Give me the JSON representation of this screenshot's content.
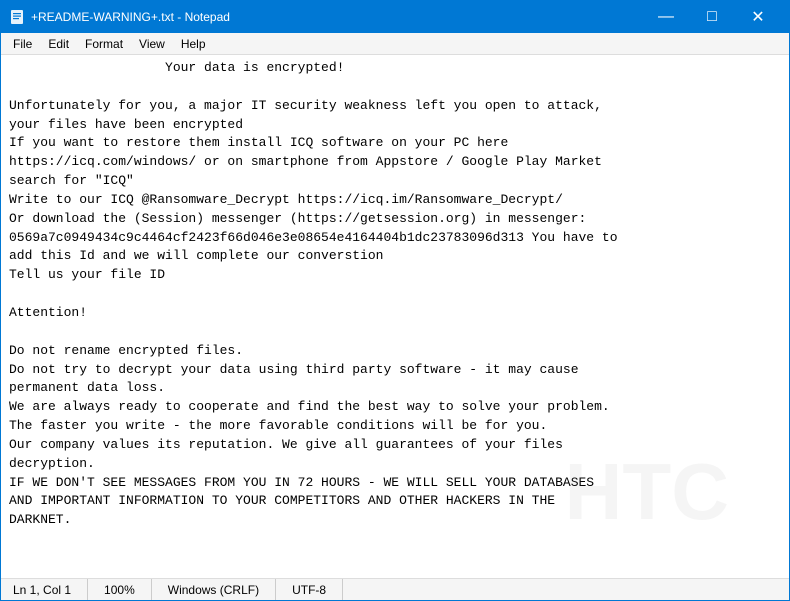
{
  "window": {
    "title": "+README-WARNING+.txt - Notepad",
    "icon": "📄"
  },
  "titlebar": {
    "minimize": "—",
    "maximize": "□",
    "close": "✕"
  },
  "menubar": {
    "items": [
      "File",
      "Edit",
      "Format",
      "View",
      "Help"
    ]
  },
  "content": "                    Your data is encrypted!\n\nUnfortunately for you, a major IT security weakness left you open to attack,\nyour files have been encrypted\nIf you want to restore them install ICQ software on your PC here\nhttps://icq.com/windows/ or on smartphone from Appstore / Google Play Market\nsearch for \"ICQ\"\nWrite to our ICQ @Ransomware_Decrypt https://icq.im/Ransomware_Decrypt/\nOr download the (Session) messenger (https://getsession.org) in messenger:\n0569a7c0949434c9c4464cf2423f66d046e3e08654e4164404b1dc23783096d313 You have to\nadd this Id and we will complete our converstion\nTell us your file ID\n\nAttention!\n\nDo not rename encrypted files.\nDo not try to decrypt your data using third party software - it may cause\npermanent data loss.\nWe are always ready to cooperate and find the best way to solve your problem.\nThe faster you write - the more favorable conditions will be for you.\nOur company values its reputation. We give all guarantees of your files\ndecryption.\nIF WE DON'T SEE MESSAGES FROM YOU IN 72 HOURS - WE WILL SELL YOUR DATABASES\nAND IMPORTANT INFORMATION TO YOUR COMPETITORS AND OTHER HACKERS IN THE\nDARKNET.",
  "statusbar": {
    "position": "Ln 1, Col 1",
    "zoom": "100%",
    "line_ending": "Windows (CRLF)",
    "encoding": "UTF-8"
  }
}
